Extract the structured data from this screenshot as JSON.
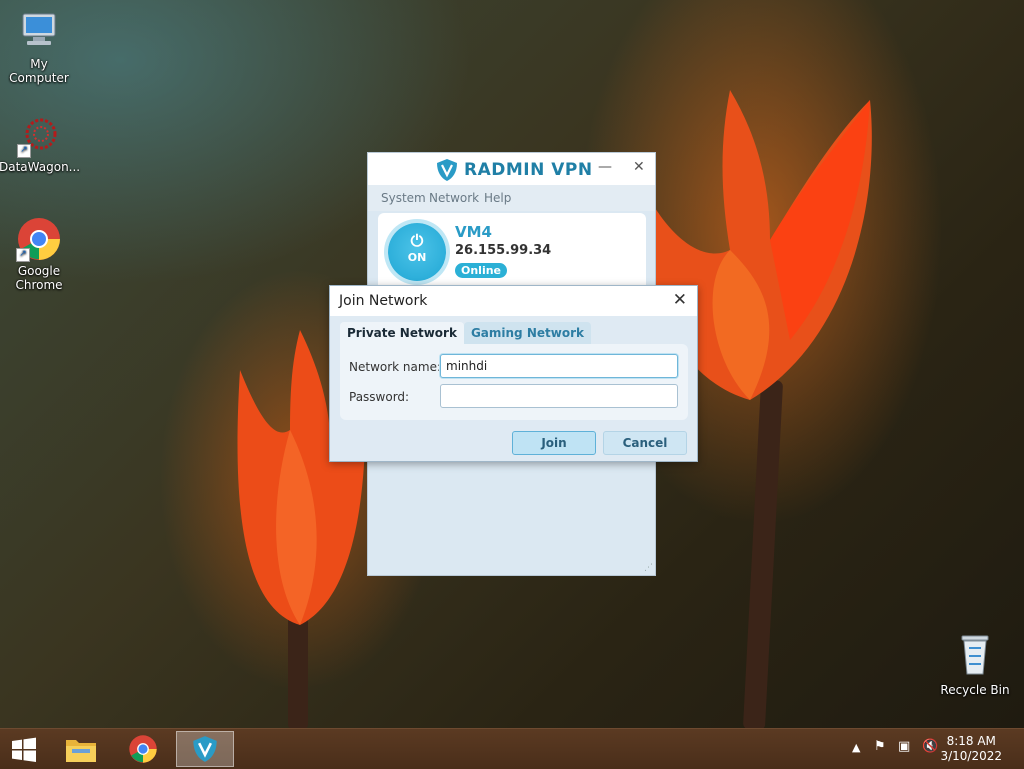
{
  "desktop": {
    "icons": [
      {
        "label": "My Computer",
        "icon": "computer-icon"
      },
      {
        "label": "DataWagon...",
        "icon": "datawagon-icon"
      },
      {
        "label": "Google Chrome",
        "icon": "chrome-icon"
      },
      {
        "label": "Recycle Bin",
        "icon": "recycle-bin-icon"
      }
    ]
  },
  "radmin": {
    "title": "RADMIN VPN",
    "minimize": "—",
    "close": "✕",
    "menu": [
      "System",
      "Network",
      "Help"
    ],
    "power_label": "ON",
    "vm_name": "VM4",
    "vm_ip": "26.155.99.34",
    "vm_status": "Online"
  },
  "join_dialog": {
    "title": "Join Network",
    "close": "✕",
    "tabs": [
      "Private Network",
      "Gaming Network"
    ],
    "network_name_label": "Network name:",
    "network_name_value": "minhdi",
    "password_label": "Password:",
    "password_value": "",
    "join_button": "Join",
    "cancel_button": "Cancel"
  },
  "taskbar": {
    "items": [
      "start-icon",
      "file-explorer-icon",
      "chrome-icon",
      "radmin-vpn-icon"
    ],
    "tray": [
      "show-hidden-icons",
      "action-center-flag-icon",
      "network-icon",
      "volume-muted-icon"
    ],
    "time": "8:18 AM",
    "date": "3/10/2022"
  }
}
